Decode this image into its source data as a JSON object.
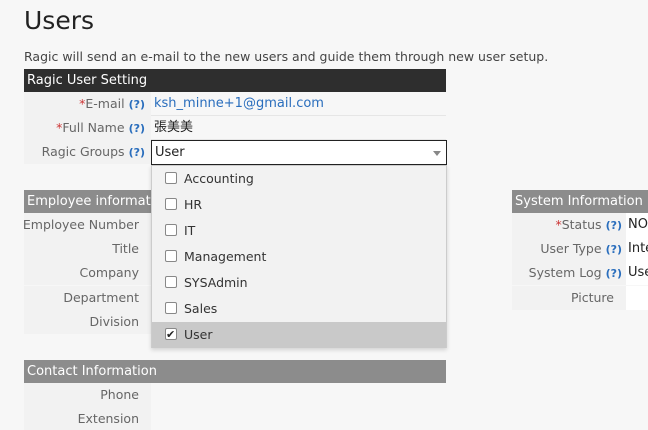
{
  "page": {
    "title": "Users",
    "intro": "Ragic will send an e-mail to the new users and guide them through new user setup."
  },
  "ragic_user_setting": {
    "header": "Ragic User Setting",
    "help": "(?)",
    "email_label": "E-mail",
    "email_value": "ksh_minne+1@gmail.com",
    "fullname_label": "Full Name",
    "fullname_value": "張美美",
    "groups_label": "Ragic Groups",
    "groups_value": "User",
    "required_mark": "*"
  },
  "groups_dropdown": {
    "options": [
      {
        "label": "Accounting",
        "checked": false
      },
      {
        "label": "HR",
        "checked": false
      },
      {
        "label": "IT",
        "checked": false
      },
      {
        "label": "Management",
        "checked": false
      },
      {
        "label": "SYSAdmin",
        "checked": false
      },
      {
        "label": "Sales",
        "checked": false
      },
      {
        "label": "User",
        "checked": true
      }
    ]
  },
  "employee_information": {
    "header": "Employee informatio",
    "fields": [
      "Employee Number",
      "Title",
      "Company",
      "Department",
      "Division"
    ]
  },
  "system_information": {
    "header": "System Information",
    "status_label": "Status",
    "status_value": "NO",
    "user_type_label": "User Type",
    "user_type_value": "Inte",
    "system_log_label": "System Log",
    "system_log_value": "Use",
    "picture_label": "Picture",
    "help": "(?)"
  },
  "contact_information": {
    "header": "Contact Information",
    "fields": [
      "Phone",
      "Extension"
    ]
  },
  "colors": {
    "header_dark": "#2e2e2e",
    "header_gray": "#8c8c8c",
    "link": "#2a6ebd",
    "required": "#cc3333"
  }
}
